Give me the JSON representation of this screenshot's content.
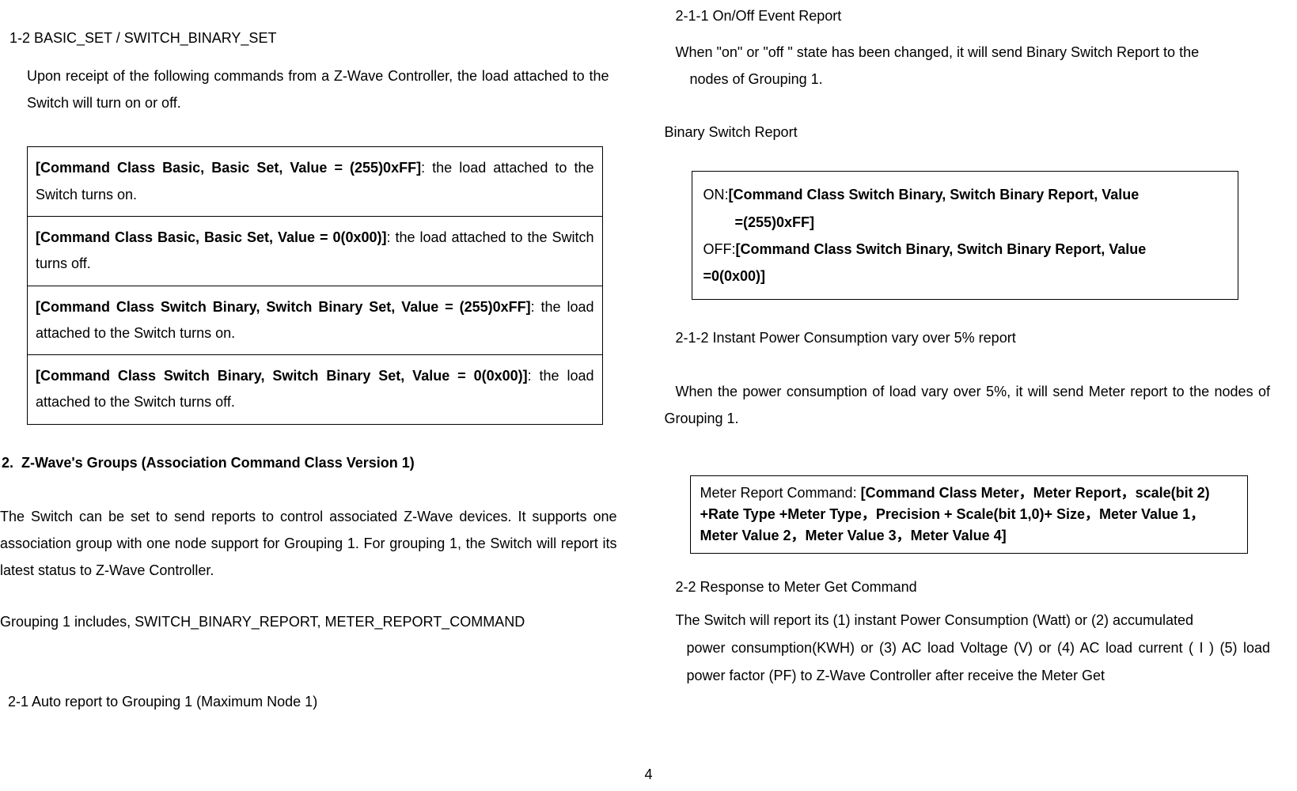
{
  "left": {
    "h12": "1-2 BASIC_SET / SWITCH_BINARY_SET",
    "intro": "Upon receipt of the following commands from a Z-Wave Controller, the load attached to the Switch will turn on or off.",
    "rows": [
      {
        "cmd": "[Command Class Basic, Basic Set, Value = (255)0xFF]",
        "txt": ": the load attached to the Switch turns on."
      },
      {
        "cmd": "[Command Class Basic, Basic Set, Value = 0(0x00)]",
        "txt": ": the load attached to the Switch turns off."
      },
      {
        "cmd": "[Command Class Switch Binary, Switch Binary Set, Value = (255)0xFF]",
        "txt": ": the load attached to the Switch turns on."
      },
      {
        "cmd": "[Command Class Switch Binary, Switch Binary Set, Value = 0(0x00)]",
        "txt": ": the load attached to the Switch turns off."
      }
    ],
    "h2num": "2.",
    "h2txt": "Z-Wave's Groups (Association Command Class Version 1)",
    "body": "The Switch can be set to send reports to control associated Z-Wave devices.  It supports one association group with one node support for Grouping 1. For grouping 1, the Switch will report its latest status to Z-Wave Controller.",
    "grp": "Grouping 1 includes, SWITCH_BINARY_REPORT, METER_REPORT_COMMAND",
    "p21": "2-1 Auto report to Grouping 1 (Maximum Node 1)"
  },
  "right": {
    "h211": "2-1-1 On/Off Event Report",
    "p211a": "When \"on\" or \"off \" state has been changed, it will send Binary Switch Report to the",
    "p211b": "nodes of Grouping 1.",
    "bsr": "Binary Switch Report",
    "on_pre": "ON:",
    "on_cmd_l1": "[Command Class Switch Binary, Switch Binary Report, Value",
    "on_cmd_l2": "=(255)0xFF]",
    "off_pre": "OFF:",
    "off_cmd_l1": "[Command Class Switch Binary, Switch Binary Report, Value",
    "off_cmd_l2": "=0(0x00)]",
    "h212": "2-1-2 Instant Power Consumption vary over 5% report",
    "p212": "When the power consumption of load vary over 5%, it will send Meter report to the nodes of Grouping 1.",
    "box2_pre": "Meter Report Command: ",
    "box2_cmd": "[Command Class Meter，Meter Report，scale(bit 2) +Rate Type +Meter Type，Precision + Scale(bit 1,0)+ Size，Meter Value 1，Meter Value 2，Meter Value 3，Meter Value 4]",
    "h22": "2-2 Response to Meter Get Command",
    "p22a": "The Switch will report its (1) instant Power Consumption (Watt)  or (2) accumulated",
    "p22b": "power consumption(KWH) or (3) AC load Voltage (V) or (4) AC load current ( I ) (5) load power factor (PF)  to Z-Wave Controller after receive the Meter Get"
  },
  "pagenum": "4"
}
